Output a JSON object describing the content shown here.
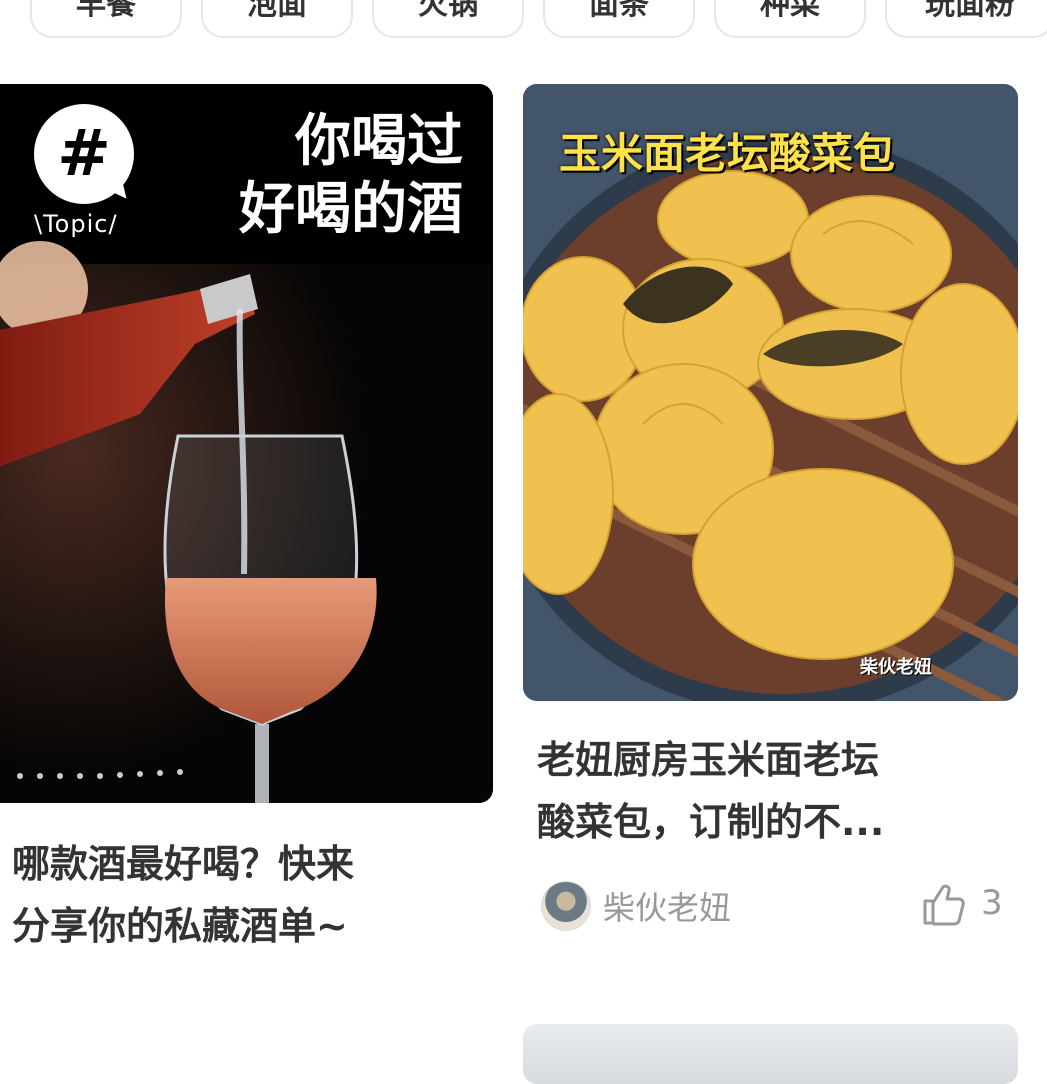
{
  "categories": [
    "早餐",
    "泡面",
    "火锅",
    "面条",
    "种菜",
    "玩面粉"
  ],
  "cards": [
    {
      "image_topic_label": "\\Topic/",
      "image_heading_line1": "你喝过",
      "image_heading_line2": "好喝的酒",
      "title_line1": "哪款酒最好喝？快来",
      "title_line2": "分享你的私藏酒单~"
    },
    {
      "image_caption": "玉米面老坛酸菜包",
      "image_watermark": "柴伙老妞",
      "title_line1": "老妞厨房玉米面老坛",
      "title_line2": "酸菜包，订制的不...",
      "author": "柴伙老妞",
      "likes": "3"
    }
  ]
}
